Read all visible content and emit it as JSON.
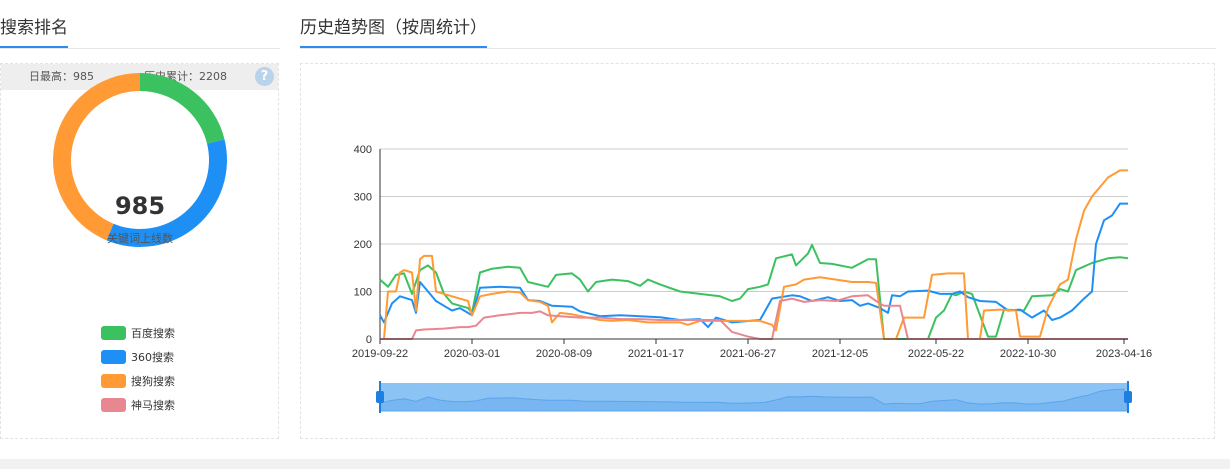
{
  "left_section": {
    "title": "搜索排名"
  },
  "right_section": {
    "title": "历史趋势图（按周统计）"
  },
  "stats": {
    "daily_max": "日最高：985",
    "total": "历史累计：2208",
    "help": "?"
  },
  "donut": {
    "value": "985",
    "label": "关键词上线数",
    "segments": [
      {
        "name": "百度搜索",
        "value": 172,
        "color": "#3cc160"
      },
      {
        "name": "360搜索",
        "value": 285,
        "color": "#1e90f5"
      },
      {
        "name": "搜狗搜索",
        "value": 355,
        "color": "#ff9a34"
      },
      {
        "name": "神马搜索",
        "value": 0,
        "color": "#e98791"
      }
    ]
  },
  "chart_data": {
    "type": "line",
    "x_start": "2019-09-22",
    "x_interval_days": 7,
    "x_count": 188,
    "x_ticks": [
      "2019-09-22",
      "2020-03-01",
      "2020-08-09",
      "2021-01-17",
      "2021-06-27",
      "2021-12-05",
      "2022-05-22",
      "2022-10-30",
      "2023-04-16"
    ],
    "ylim": [
      0,
      400
    ],
    "y_ticks": [
      0,
      100,
      200,
      300,
      400
    ],
    "grid": true,
    "data_zoom": true,
    "series": [
      {
        "name": "百度搜索",
        "color": "#3cc160",
        "points": [
          [
            0,
            125
          ],
          [
            2,
            110
          ],
          [
            4,
            135
          ],
          [
            6,
            138
          ],
          [
            8,
            95
          ],
          [
            10,
            145
          ],
          [
            12,
            155
          ],
          [
            14,
            140
          ],
          [
            16,
            95
          ],
          [
            18,
            75
          ],
          [
            22,
            65
          ],
          [
            23,
            55
          ],
          [
            25,
            140
          ],
          [
            28,
            148
          ],
          [
            32,
            152
          ],
          [
            35,
            150
          ],
          [
            37,
            120
          ],
          [
            42,
            110
          ],
          [
            44,
            135
          ],
          [
            48,
            138
          ],
          [
            50,
            125
          ],
          [
            52,
            100
          ],
          [
            54,
            120
          ],
          [
            58,
            125
          ],
          [
            62,
            122
          ],
          [
            65,
            112
          ],
          [
            67,
            125
          ],
          [
            70,
            115
          ],
          [
            75,
            100
          ],
          [
            80,
            95
          ],
          [
            85,
            90
          ],
          [
            88,
            80
          ],
          [
            90,
            85
          ],
          [
            92,
            105
          ],
          [
            95,
            110
          ],
          [
            97,
            115
          ],
          [
            99,
            170
          ],
          [
            103,
            178
          ],
          [
            104,
            155
          ],
          [
            107,
            180
          ],
          [
            108,
            198
          ],
          [
            110,
            160
          ],
          [
            113,
            158
          ],
          [
            118,
            150
          ],
          [
            122,
            168
          ],
          [
            124,
            168
          ],
          [
            126,
            0
          ],
          [
            137,
            0
          ],
          [
            139,
            45
          ],
          [
            141,
            60
          ],
          [
            143,
            95
          ],
          [
            144,
            92
          ],
          [
            146,
            100
          ],
          [
            148,
            95
          ],
          [
            152,
            5
          ],
          [
            154,
            5
          ],
          [
            156,
            62
          ],
          [
            161,
            60
          ],
          [
            163,
            90
          ],
          [
            168,
            92
          ],
          [
            170,
            105
          ],
          [
            172,
            100
          ],
          [
            174,
            145
          ],
          [
            178,
            160
          ],
          [
            182,
            170
          ],
          [
            185,
            172
          ],
          [
            187,
            170
          ]
        ]
      },
      {
        "name": "360搜索",
        "color": "#1e90f5",
        "points": [
          [
            0,
            50
          ],
          [
            1,
            35
          ],
          [
            3,
            75
          ],
          [
            5,
            90
          ],
          [
            8,
            82
          ],
          [
            9,
            55
          ],
          [
            10,
            120
          ],
          [
            12,
            100
          ],
          [
            14,
            80
          ],
          [
            16,
            70
          ],
          [
            18,
            60
          ],
          [
            20,
            65
          ],
          [
            22,
            55
          ],
          [
            23,
            50
          ],
          [
            25,
            108
          ],
          [
            30,
            110
          ],
          [
            35,
            108
          ],
          [
            37,
            82
          ],
          [
            40,
            80
          ],
          [
            43,
            70
          ],
          [
            48,
            68
          ],
          [
            50,
            58
          ],
          [
            55,
            48
          ],
          [
            60,
            50
          ],
          [
            65,
            48
          ],
          [
            70,
            46
          ],
          [
            75,
            40
          ],
          [
            80,
            42
          ],
          [
            82,
            25
          ],
          [
            84,
            45
          ],
          [
            88,
            35
          ],
          [
            95,
            40
          ],
          [
            98,
            85
          ],
          [
            103,
            92
          ],
          [
            105,
            90
          ],
          [
            108,
            80
          ],
          [
            112,
            88
          ],
          [
            115,
            80
          ],
          [
            118,
            82
          ],
          [
            120,
            70
          ],
          [
            122,
            75
          ],
          [
            125,
            65
          ],
          [
            127,
            55
          ],
          [
            128,
            92
          ],
          [
            130,
            90
          ],
          [
            132,
            100
          ],
          [
            137,
            102
          ],
          [
            140,
            95
          ],
          [
            143,
            95
          ],
          [
            145,
            100
          ],
          [
            147,
            88
          ],
          [
            150,
            80
          ],
          [
            154,
            78
          ],
          [
            157,
            60
          ],
          [
            160,
            62
          ],
          [
            163,
            45
          ],
          [
            166,
            60
          ],
          [
            168,
            40
          ],
          [
            170,
            45
          ],
          [
            173,
            60
          ],
          [
            176,
            85
          ],
          [
            178,
            100
          ],
          [
            179,
            200
          ],
          [
            181,
            250
          ],
          [
            183,
            260
          ],
          [
            185,
            285
          ],
          [
            187,
            285
          ]
        ]
      },
      {
        "name": "搜狗搜索",
        "color": "#ff9a34",
        "points": [
          [
            0,
            0
          ],
          [
            1,
            0
          ],
          [
            2,
            100
          ],
          [
            4,
            100
          ],
          [
            5,
            140
          ],
          [
            6,
            145
          ],
          [
            8,
            140
          ],
          [
            9,
            60
          ],
          [
            10,
            168
          ],
          [
            11,
            175
          ],
          [
            13,
            175
          ],
          [
            14,
            100
          ],
          [
            16,
            95
          ],
          [
            18,
            90
          ],
          [
            22,
            80
          ],
          [
            23,
            50
          ],
          [
            25,
            90
          ],
          [
            28,
            95
          ],
          [
            32,
            100
          ],
          [
            35,
            98
          ],
          [
            37,
            82
          ],
          [
            40,
            78
          ],
          [
            42,
            70
          ],
          [
            43,
            35
          ],
          [
            45,
            55
          ],
          [
            48,
            52
          ],
          [
            52,
            45
          ],
          [
            55,
            40
          ],
          [
            58,
            38
          ],
          [
            62,
            40
          ],
          [
            67,
            35
          ],
          [
            72,
            35
          ],
          [
            75,
            35
          ],
          [
            77,
            30
          ],
          [
            80,
            38
          ],
          [
            85,
            38
          ],
          [
            90,
            38
          ],
          [
            95,
            38
          ],
          [
            98,
            30
          ],
          [
            99,
            18
          ],
          [
            101,
            110
          ],
          [
            104,
            115
          ],
          [
            106,
            125
          ],
          [
            110,
            130
          ],
          [
            114,
            125
          ],
          [
            118,
            120
          ],
          [
            122,
            120
          ],
          [
            124,
            118
          ],
          [
            126,
            0
          ],
          [
            129,
            0
          ],
          [
            131,
            45
          ],
          [
            136,
            45
          ],
          [
            138,
            135
          ],
          [
            142,
            138
          ],
          [
            146,
            138
          ],
          [
            147,
            0
          ],
          [
            150,
            0
          ],
          [
            151,
            60
          ],
          [
            155,
            62
          ],
          [
            159,
            60
          ],
          [
            160,
            5
          ],
          [
            165,
            5
          ],
          [
            167,
            65
          ],
          [
            170,
            115
          ],
          [
            172,
            125
          ],
          [
            174,
            210
          ],
          [
            176,
            270
          ],
          [
            178,
            300
          ],
          [
            180,
            320
          ],
          [
            182,
            340
          ],
          [
            185,
            355
          ],
          [
            187,
            355
          ]
        ]
      },
      {
        "name": "神马搜索",
        "color": "#e98791",
        "points": [
          [
            0,
            0
          ],
          [
            8,
            0
          ],
          [
            9,
            18
          ],
          [
            11,
            20
          ],
          [
            16,
            22
          ],
          [
            20,
            25
          ],
          [
            22,
            25
          ],
          [
            24,
            28
          ],
          [
            26,
            45
          ],
          [
            30,
            50
          ],
          [
            35,
            55
          ],
          [
            38,
            55
          ],
          [
            40,
            58
          ],
          [
            42,
            50
          ],
          [
            45,
            48
          ],
          [
            50,
            45
          ],
          [
            55,
            45
          ],
          [
            60,
            42
          ],
          [
            65,
            42
          ],
          [
            70,
            40
          ],
          [
            75,
            40
          ],
          [
            80,
            40
          ],
          [
            85,
            40
          ],
          [
            88,
            15
          ],
          [
            92,
            5
          ],
          [
            95,
            0
          ],
          [
            98,
            0
          ],
          [
            100,
            80
          ],
          [
            103,
            85
          ],
          [
            106,
            78
          ],
          [
            110,
            82
          ],
          [
            114,
            80
          ],
          [
            118,
            90
          ],
          [
            122,
            92
          ],
          [
            124,
            80
          ],
          [
            126,
            70
          ],
          [
            130,
            70
          ],
          [
            132,
            0
          ],
          [
            187,
            0
          ]
        ]
      }
    ]
  }
}
